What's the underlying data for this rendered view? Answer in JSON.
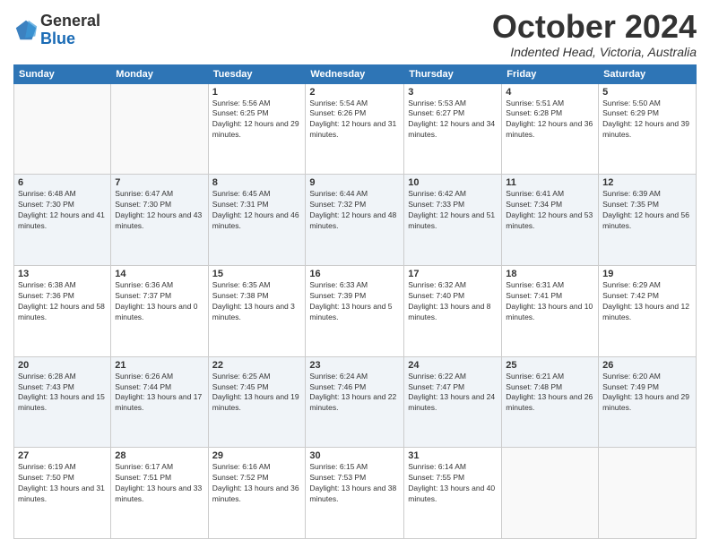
{
  "header": {
    "logo_line1": "General",
    "logo_line2": "Blue",
    "month": "October 2024",
    "location": "Indented Head, Victoria, Australia"
  },
  "days_of_week": [
    "Sunday",
    "Monday",
    "Tuesday",
    "Wednesday",
    "Thursday",
    "Friday",
    "Saturday"
  ],
  "weeks": [
    [
      {
        "day": "",
        "info": ""
      },
      {
        "day": "",
        "info": ""
      },
      {
        "day": "1",
        "info": "Sunrise: 5:56 AM\nSunset: 6:25 PM\nDaylight: 12 hours and 29 minutes."
      },
      {
        "day": "2",
        "info": "Sunrise: 5:54 AM\nSunset: 6:26 PM\nDaylight: 12 hours and 31 minutes."
      },
      {
        "day": "3",
        "info": "Sunrise: 5:53 AM\nSunset: 6:27 PM\nDaylight: 12 hours and 34 minutes."
      },
      {
        "day": "4",
        "info": "Sunrise: 5:51 AM\nSunset: 6:28 PM\nDaylight: 12 hours and 36 minutes."
      },
      {
        "day": "5",
        "info": "Sunrise: 5:50 AM\nSunset: 6:29 PM\nDaylight: 12 hours and 39 minutes."
      }
    ],
    [
      {
        "day": "6",
        "info": "Sunrise: 6:48 AM\nSunset: 7:30 PM\nDaylight: 12 hours and 41 minutes."
      },
      {
        "day": "7",
        "info": "Sunrise: 6:47 AM\nSunset: 7:30 PM\nDaylight: 12 hours and 43 minutes."
      },
      {
        "day": "8",
        "info": "Sunrise: 6:45 AM\nSunset: 7:31 PM\nDaylight: 12 hours and 46 minutes."
      },
      {
        "day": "9",
        "info": "Sunrise: 6:44 AM\nSunset: 7:32 PM\nDaylight: 12 hours and 48 minutes."
      },
      {
        "day": "10",
        "info": "Sunrise: 6:42 AM\nSunset: 7:33 PM\nDaylight: 12 hours and 51 minutes."
      },
      {
        "day": "11",
        "info": "Sunrise: 6:41 AM\nSunset: 7:34 PM\nDaylight: 12 hours and 53 minutes."
      },
      {
        "day": "12",
        "info": "Sunrise: 6:39 AM\nSunset: 7:35 PM\nDaylight: 12 hours and 56 minutes."
      }
    ],
    [
      {
        "day": "13",
        "info": "Sunrise: 6:38 AM\nSunset: 7:36 PM\nDaylight: 12 hours and 58 minutes."
      },
      {
        "day": "14",
        "info": "Sunrise: 6:36 AM\nSunset: 7:37 PM\nDaylight: 13 hours and 0 minutes."
      },
      {
        "day": "15",
        "info": "Sunrise: 6:35 AM\nSunset: 7:38 PM\nDaylight: 13 hours and 3 minutes."
      },
      {
        "day": "16",
        "info": "Sunrise: 6:33 AM\nSunset: 7:39 PM\nDaylight: 13 hours and 5 minutes."
      },
      {
        "day": "17",
        "info": "Sunrise: 6:32 AM\nSunset: 7:40 PM\nDaylight: 13 hours and 8 minutes."
      },
      {
        "day": "18",
        "info": "Sunrise: 6:31 AM\nSunset: 7:41 PM\nDaylight: 13 hours and 10 minutes."
      },
      {
        "day": "19",
        "info": "Sunrise: 6:29 AM\nSunset: 7:42 PM\nDaylight: 13 hours and 12 minutes."
      }
    ],
    [
      {
        "day": "20",
        "info": "Sunrise: 6:28 AM\nSunset: 7:43 PM\nDaylight: 13 hours and 15 minutes."
      },
      {
        "day": "21",
        "info": "Sunrise: 6:26 AM\nSunset: 7:44 PM\nDaylight: 13 hours and 17 minutes."
      },
      {
        "day": "22",
        "info": "Sunrise: 6:25 AM\nSunset: 7:45 PM\nDaylight: 13 hours and 19 minutes."
      },
      {
        "day": "23",
        "info": "Sunrise: 6:24 AM\nSunset: 7:46 PM\nDaylight: 13 hours and 22 minutes."
      },
      {
        "day": "24",
        "info": "Sunrise: 6:22 AM\nSunset: 7:47 PM\nDaylight: 13 hours and 24 minutes."
      },
      {
        "day": "25",
        "info": "Sunrise: 6:21 AM\nSunset: 7:48 PM\nDaylight: 13 hours and 26 minutes."
      },
      {
        "day": "26",
        "info": "Sunrise: 6:20 AM\nSunset: 7:49 PM\nDaylight: 13 hours and 29 minutes."
      }
    ],
    [
      {
        "day": "27",
        "info": "Sunrise: 6:19 AM\nSunset: 7:50 PM\nDaylight: 13 hours and 31 minutes."
      },
      {
        "day": "28",
        "info": "Sunrise: 6:17 AM\nSunset: 7:51 PM\nDaylight: 13 hours and 33 minutes."
      },
      {
        "day": "29",
        "info": "Sunrise: 6:16 AM\nSunset: 7:52 PM\nDaylight: 13 hours and 36 minutes."
      },
      {
        "day": "30",
        "info": "Sunrise: 6:15 AM\nSunset: 7:53 PM\nDaylight: 13 hours and 38 minutes."
      },
      {
        "day": "31",
        "info": "Sunrise: 6:14 AM\nSunset: 7:55 PM\nDaylight: 13 hours and 40 minutes."
      },
      {
        "day": "",
        "info": ""
      },
      {
        "day": "",
        "info": ""
      }
    ]
  ]
}
